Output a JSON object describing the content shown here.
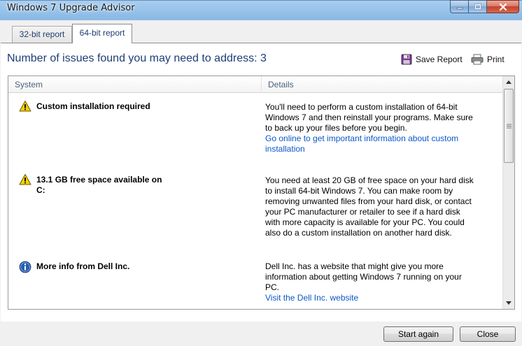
{
  "window": {
    "title": "Windows 7 Upgrade Advisor"
  },
  "tabs": [
    {
      "label": "32-bit report",
      "selected": false
    },
    {
      "label": "64-bit report",
      "selected": true
    }
  ],
  "report": {
    "heading": "Number of issues found you may need to address: 3",
    "save_label": "Save Report",
    "print_label": "Print"
  },
  "columns": {
    "system": "System",
    "details": "Details"
  },
  "issues": [
    {
      "icon": "warning-icon",
      "title": "Custom installation required",
      "detail": "You'll need to perform a custom installation of 64-bit Windows 7 and then reinstall your programs. Make sure to back up your files before you begin.",
      "link": "Go online to get important information about custom installation"
    },
    {
      "icon": "warning-icon",
      "title": "13.1 GB free space available on C:",
      "detail": "You need at least 20 GB of free space on your hard disk to install 64-bit Windows 7. You can make room by removing unwanted files from your hard disk, or contact your PC manufacturer or retailer to see if a hard disk with more capacity is available for your PC. You could also do a custom installation on another hard disk.",
      "link": ""
    },
    {
      "icon": "info-icon",
      "title": "More info from Dell Inc.",
      "detail": "Dell Inc. has a website that might give you more information about getting Windows 7 running on your PC.",
      "link": "Visit the Dell Inc. website"
    }
  ],
  "footer": {
    "start_again_label": "Start again",
    "close_label": "Close"
  },
  "colors": {
    "heading": "#1f3c78",
    "link": "#0b57c9",
    "warning": "#f5d000",
    "info": "#2a5db0"
  }
}
